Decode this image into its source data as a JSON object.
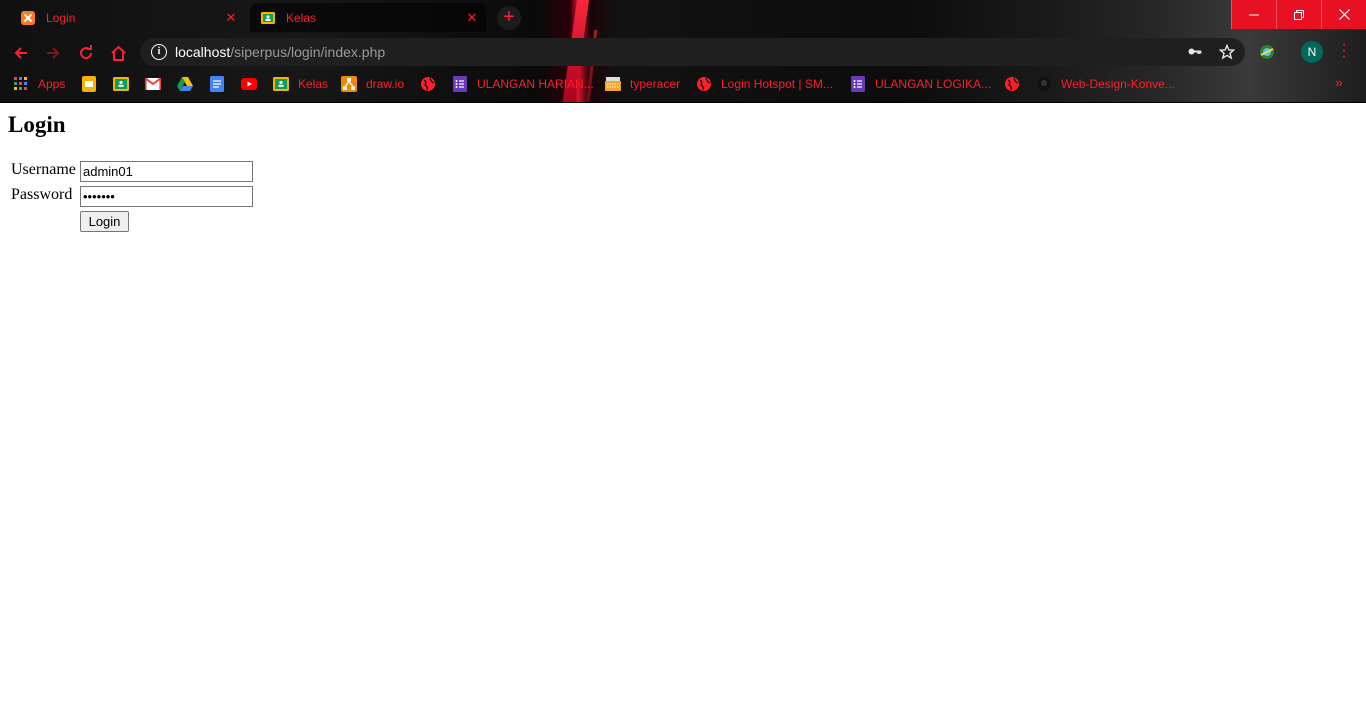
{
  "browser": {
    "tabs": [
      {
        "title": "Login",
        "active": true
      },
      {
        "title": "Kelas",
        "active": false
      }
    ],
    "address": {
      "host": "localhost",
      "path": "/siperpus/login/index.php"
    },
    "profile_initial": "N",
    "bookmarks": [
      {
        "label": "Apps",
        "icon": "apps-grid-icon"
      },
      {
        "label": "",
        "icon": "slides-icon"
      },
      {
        "label": "",
        "icon": "classroom-icon"
      },
      {
        "label": "",
        "icon": "gmail-icon"
      },
      {
        "label": "",
        "icon": "drive-icon"
      },
      {
        "label": "",
        "icon": "docs-icon"
      },
      {
        "label": "",
        "icon": "youtube-icon"
      },
      {
        "label": "Kelas",
        "icon": "classroom-icon"
      },
      {
        "label": "draw.io",
        "icon": "drawio-icon"
      },
      {
        "label": "",
        "icon": "globe-icon"
      },
      {
        "label": "ULANGAN HARIAN...",
        "icon": "forms-icon"
      },
      {
        "label": "typeracer",
        "icon": "typeracer-icon"
      },
      {
        "label": "Login Hotspot | SM...",
        "icon": "globe-icon"
      },
      {
        "label": "ULANGAN LOGIKA...",
        "icon": "forms-icon"
      },
      {
        "label": "",
        "icon": "globe-icon"
      },
      {
        "label": "Web-Design-Konve...",
        "icon": "github-icon"
      }
    ],
    "colors": {
      "accent": "#ff1e2e",
      "window_controls": "#e81123"
    }
  },
  "page": {
    "title": "Login",
    "form": {
      "username_label": "Username",
      "username_value": "admin01",
      "password_label": "Password",
      "password_value": "•••••••",
      "submit_label": "Login"
    }
  }
}
